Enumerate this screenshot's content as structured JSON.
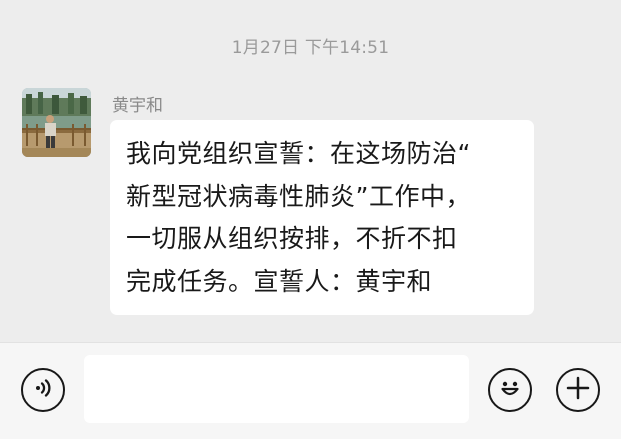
{
  "conversation": {
    "timestamp": "1月27日 下午14:51"
  },
  "message": {
    "sender_name": "黄宇和",
    "text": "我向党组织宣誓：在这场防治“\n新型冠状病毒性肺炎”工作中，\n一切服从组织按排，不折不扣\n完成任务。宣誓人：黄宇和"
  },
  "input_bar": {
    "voice_icon": "voice-icon",
    "emoji_icon": "emoji-icon",
    "plus_icon": "plus-icon",
    "input_value": ""
  },
  "colors": {
    "chat_background": "#ededed",
    "bubble_background": "#ffffff",
    "input_bar_background": "#f6f6f6",
    "icon_stroke": "#181818"
  }
}
